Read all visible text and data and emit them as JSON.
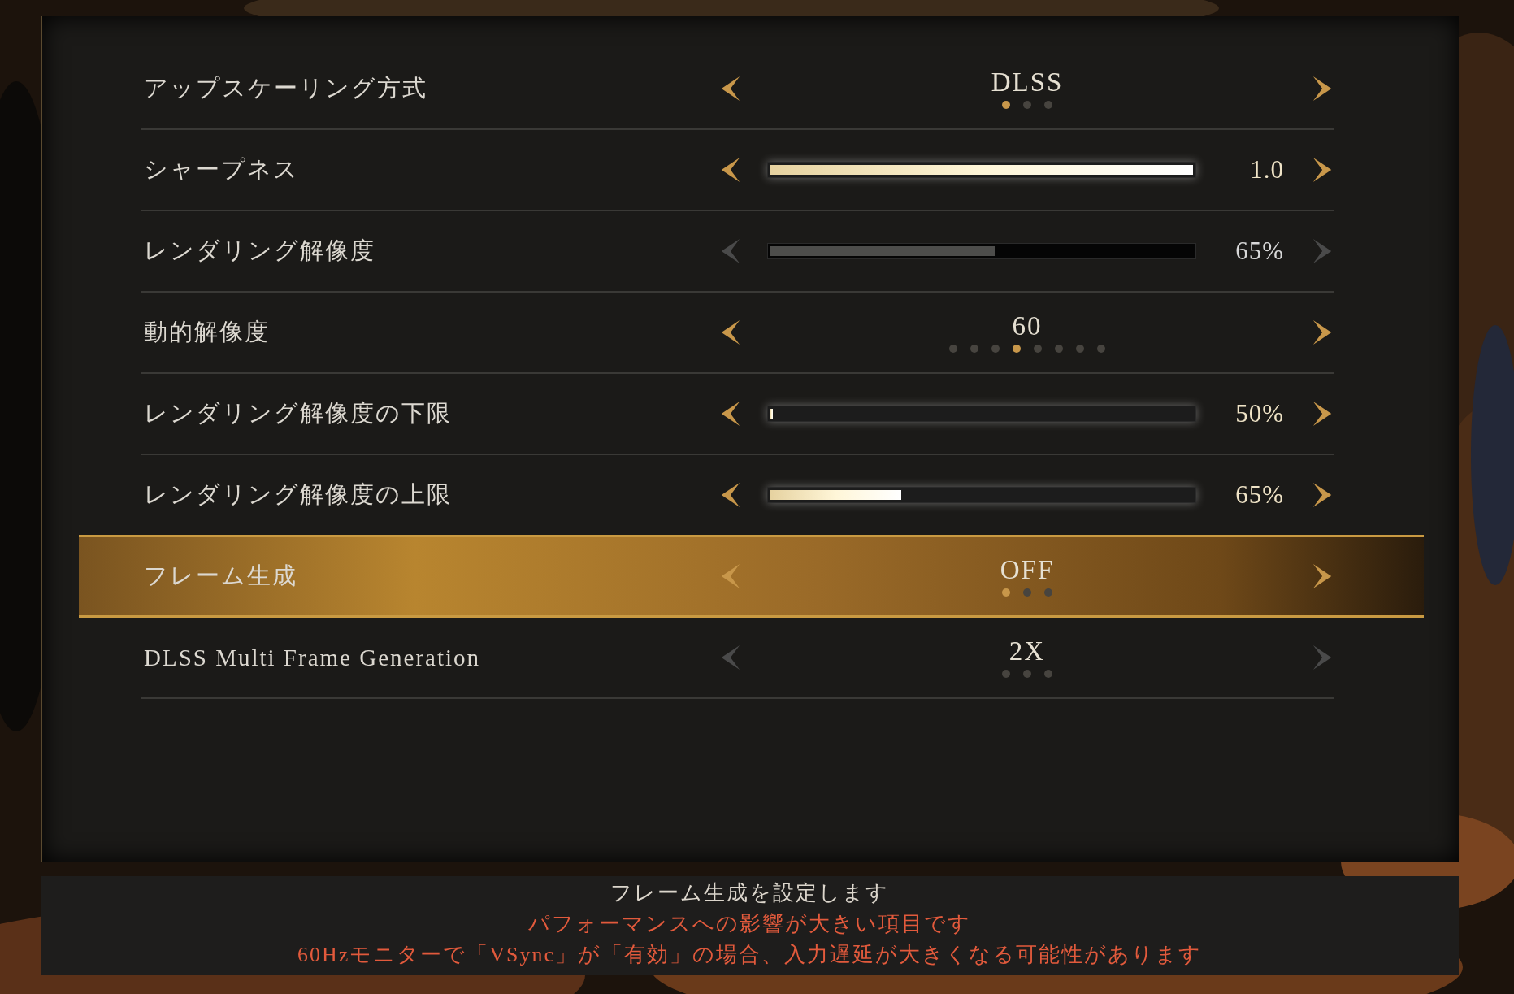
{
  "settings": [
    {
      "label": "アップスケーリング方式",
      "kind": "choice",
      "value": "DLSS",
      "disabled": false,
      "selected": false,
      "dots": [
        {
          "selected": true
        },
        {
          "selected": false
        },
        {
          "selected": false
        }
      ]
    },
    {
      "label": "シャープネス",
      "kind": "slider",
      "level": 1.0,
      "reading": "1.0",
      "disabled": false,
      "selected": false
    },
    {
      "label": "レンダリング解像度",
      "kind": "slider",
      "level": 0.53,
      "reading": "65%",
      "disabled": true,
      "selected": false
    },
    {
      "label": "動的解像度",
      "kind": "choice",
      "value": "60",
      "disabled": false,
      "selected": false,
      "dots": [
        {
          "selected": false
        },
        {
          "selected": false
        },
        {
          "selected": false
        },
        {
          "selected": true
        },
        {
          "selected": false
        },
        {
          "selected": false
        },
        {
          "selected": false
        },
        {
          "selected": false
        }
      ]
    },
    {
      "label": "レンダリング解像度の下限",
      "kind": "slider",
      "level": 0.005,
      "reading": "50%",
      "disabled": false,
      "selected": false
    },
    {
      "label": "レンダリング解像度の上限",
      "kind": "slider",
      "level": 0.31,
      "reading": "65%",
      "disabled": false,
      "selected": false
    },
    {
      "label": "フレーム生成",
      "kind": "choice",
      "value": "OFF",
      "disabled": false,
      "selected": true,
      "dots": [
        {
          "selected": true
        },
        {
          "selected": false
        },
        {
          "selected": false
        }
      ]
    },
    {
      "label": "DLSS Multi Frame Generation",
      "kind": "choice",
      "value": "2X",
      "disabled": true,
      "selected": false,
      "dots": [
        {
          "selected": false
        },
        {
          "selected": false
        },
        {
          "selected": false
        }
      ]
    }
  ],
  "description": [
    {
      "text": "フレーム生成を設定します",
      "kind": "note"
    },
    {
      "text": "パフォーマンスへの影響が大きい項目です",
      "kind": "warning"
    },
    {
      "text": "60Hzモニターで「VSync」が「有効」の場合、入力遅延が大きくなる可能性があります",
      "kind": "warning"
    }
  ]
}
